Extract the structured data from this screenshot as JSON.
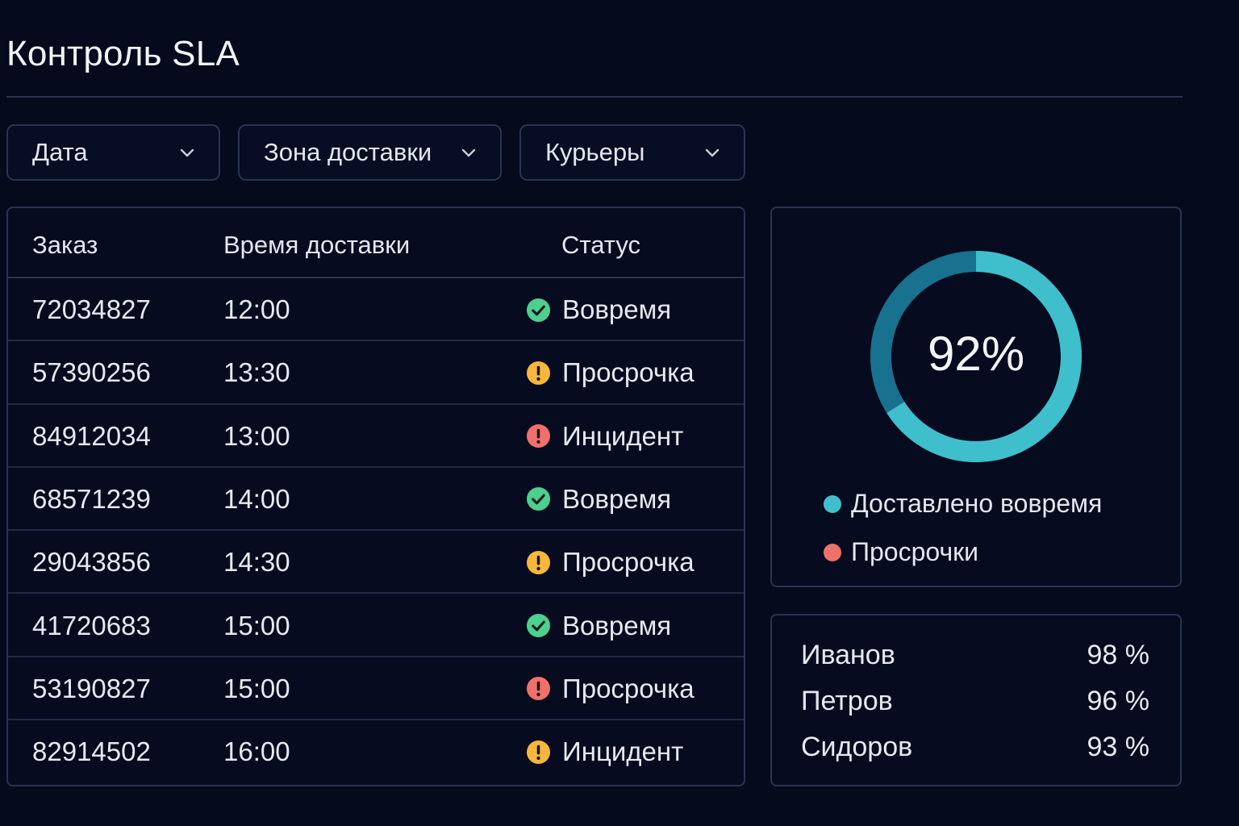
{
  "title": "Контроль SLA",
  "filters": [
    {
      "label": "Дата"
    },
    {
      "label": "Зона доставки"
    },
    {
      "label": "Курьеры"
    }
  ],
  "table": {
    "headers": {
      "order": "Заказ",
      "time": "Время доставки",
      "status": "Статус"
    },
    "rows": [
      {
        "order": "72034827",
        "time": "12:00",
        "status": "Вовремя",
        "icon": "check-circle-icon",
        "color": "#4ccf8f"
      },
      {
        "order": "57390256",
        "time": "13:30",
        "status": "Просрочка",
        "icon": "warning-circle-icon",
        "color": "#f6b73c"
      },
      {
        "order": "84912034",
        "time": "13:00",
        "status": "Инцидент",
        "icon": "alert-circle-icon",
        "color": "#f0706a"
      },
      {
        "order": "68571239",
        "time": "14:00",
        "status": "Вовремя",
        "icon": "check-circle-icon",
        "color": "#4ccf8f"
      },
      {
        "order": "29043856",
        "time": "14:30",
        "status": "Просрочка",
        "icon": "warning-circle-icon",
        "color": "#f6b73c"
      },
      {
        "order": "41720683",
        "time": "15:00",
        "status": "Вовремя",
        "icon": "check-circle-icon",
        "color": "#4ccf8f"
      },
      {
        "order": "53190827",
        "time": "15:00",
        "status": "Просрочка",
        "icon": "alert-circle-icon",
        "color": "#f0706a"
      },
      {
        "order": "82914502",
        "time": "16:00",
        "status": "Инцидент",
        "icon": "warning-circle-icon",
        "color": "#f6b73c"
      }
    ]
  },
  "sla": {
    "percent_label": "92%",
    "on_time_fraction": 0.92,
    "legend": [
      {
        "label": "Доставлено вовремя",
        "color": "#3fbfcc"
      },
      {
        "label": "Просрочки",
        "color": "#f0706a"
      }
    ],
    "ring_colors": {
      "on_time": "#3fbfcc",
      "late": "#18718f"
    }
  },
  "couriers": [
    {
      "name": "Иванов",
      "value": "98 %"
    },
    {
      "name": "Петров",
      "value": "96 %"
    },
    {
      "name": "Сидоров",
      "value": "93 %"
    }
  ]
}
